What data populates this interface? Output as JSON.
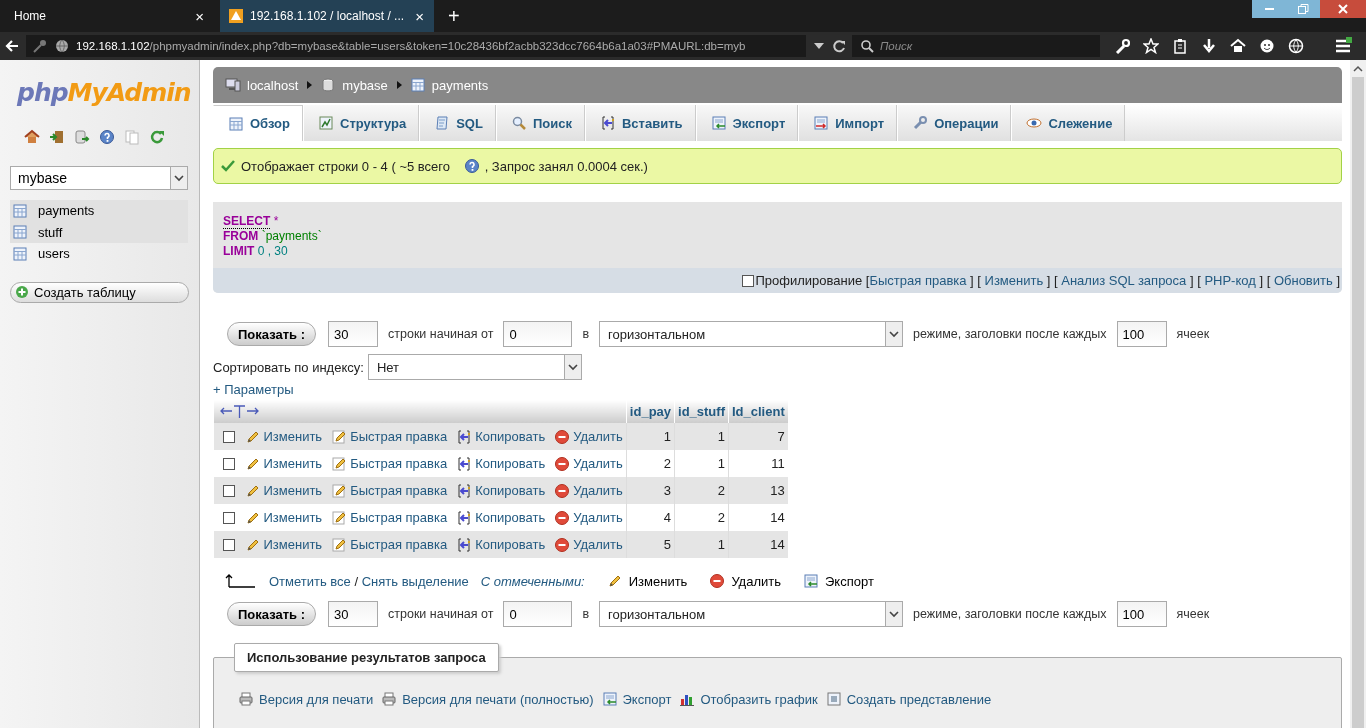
{
  "browser": {
    "tabs": [
      {
        "title": "Home",
        "selected": false,
        "close": "×"
      },
      {
        "title": "192.168.1.102 / localhost / ...",
        "selected": true,
        "close": "×"
      }
    ],
    "new_tab": "+",
    "address": {
      "host": "192.168.1.102",
      "path": "/phpmyadmin/index.php?db=mybase&table=users&token=10c28436bf2acbb323dcc7664b6a1a03#PMAURL:db=myb"
    },
    "search": {
      "placeholder": "Поиск"
    }
  },
  "sidebar": {
    "logo": {
      "php": "php",
      "myadmin": "MyAdmin"
    },
    "database": "mybase",
    "tables": [
      {
        "name": "payments",
        "marked": true
      },
      {
        "name": "stuff",
        "marked": true
      },
      {
        "name": "users",
        "marked": false
      }
    ],
    "create_table": "Создать таблицу"
  },
  "main": {
    "breadcrumbs": [
      {
        "kind": "server",
        "label": "localhost"
      },
      {
        "kind": "database",
        "label": "mybase"
      },
      {
        "kind": "table",
        "label": "payments"
      }
    ],
    "tabs": [
      {
        "kind": "browse",
        "label": "Обзор",
        "selected": true
      },
      {
        "kind": "structure",
        "label": "Структура",
        "selected": false
      },
      {
        "kind": "sql",
        "label": "SQL",
        "selected": false
      },
      {
        "kind": "search",
        "label": "Поиск",
        "selected": false
      },
      {
        "kind": "insert",
        "label": "Вставить",
        "selected": false
      },
      {
        "kind": "export",
        "label": "Экспорт",
        "selected": false
      },
      {
        "kind": "import",
        "label": "Импорт",
        "selected": false
      },
      {
        "kind": "operations",
        "label": "Операции",
        "selected": false
      },
      {
        "kind": "tracking",
        "label": "Слежение",
        "selected": false
      }
    ],
    "notice": {
      "before": "Отображает строки 0 - 4 ( ~5 всего",
      "after": ", Запрос занял 0.0004 сек.)"
    },
    "sql": [
      {
        "keyword": "SELECT",
        "args": "*"
      },
      {
        "keyword": "FROM",
        "args": "`payments`"
      },
      {
        "keyword": "LIMIT",
        "args": "0 , 30"
      }
    ],
    "profiling": {
      "label": "Профилирование",
      "checked": false,
      "open": "[",
      "close": "]",
      "links": [
        "Быстрая правка",
        "Изменить",
        "Анализ SQL запроса",
        "PHP-код",
        "Обновить"
      ]
    },
    "nav_top": {
      "button": "Показать :",
      "rows": "30",
      "from_label": "строки начиная от",
      "start": "0",
      "in_label": "в",
      "mode": "горизонтальном",
      "after_label": "режиме, заголовки после каждых",
      "repeat": "100",
      "cells_label": "ячеек"
    },
    "sort": {
      "label": "Сортировать по индексу:",
      "value": "Нет"
    },
    "options_link": "+ Параметры",
    "table": {
      "columns": [
        "id_pay",
        "id_stuff",
        "Id_client"
      ],
      "rows": [
        {
          "checked": false,
          "actions": [
            "Изменить",
            "Быстрая правка",
            "Копировать",
            "Удалить"
          ],
          "cells": [
            "1",
            "1",
            "7"
          ]
        },
        {
          "checked": false,
          "actions": [
            "Изменить",
            "Быстрая правка",
            "Копировать",
            "Удалить"
          ],
          "cells": [
            "2",
            "1",
            "11"
          ]
        },
        {
          "checked": false,
          "actions": [
            "Изменить",
            "Быстрая правка",
            "Копировать",
            "Удалить"
          ],
          "cells": [
            "3",
            "2",
            "13"
          ]
        },
        {
          "checked": false,
          "actions": [
            "Изменить",
            "Быстрая правка",
            "Копировать",
            "Удалить"
          ],
          "cells": [
            "4",
            "2",
            "14"
          ]
        },
        {
          "checked": false,
          "actions": [
            "Изменить",
            "Быстрая правка",
            "Копировать",
            "Удалить"
          ],
          "cells": [
            "5",
            "1",
            "14"
          ]
        }
      ]
    },
    "bulk": {
      "check_all": "Отметить все",
      "separator": "/",
      "uncheck_all": "Снять выделение",
      "with_selected": "С отмеченными:",
      "actions": [
        {
          "kind": "edit",
          "label": "Изменить"
        },
        {
          "kind": "delete",
          "label": "Удалить"
        },
        {
          "kind": "export",
          "label": "Экспорт"
        }
      ]
    },
    "nav_bottom": {
      "button": "Показать :",
      "rows": "30",
      "from_label": "строки начиная от",
      "start": "0",
      "in_label": "в",
      "mode": "горизонтальном",
      "after_label": "режиме, заголовки после каждых",
      "repeat": "100",
      "cells_label": "ячеек"
    },
    "query_results": {
      "legend": "Использование результатов запроса",
      "links": [
        {
          "kind": "print",
          "label": "Версия для печати"
        },
        {
          "kind": "print",
          "label": "Версия для печати (полностью)"
        },
        {
          "kind": "export",
          "label": "Экспорт"
        },
        {
          "kind": "chart",
          "label": "Отобразить график"
        },
        {
          "kind": "view",
          "label": "Создать представление"
        }
      ]
    }
  }
}
